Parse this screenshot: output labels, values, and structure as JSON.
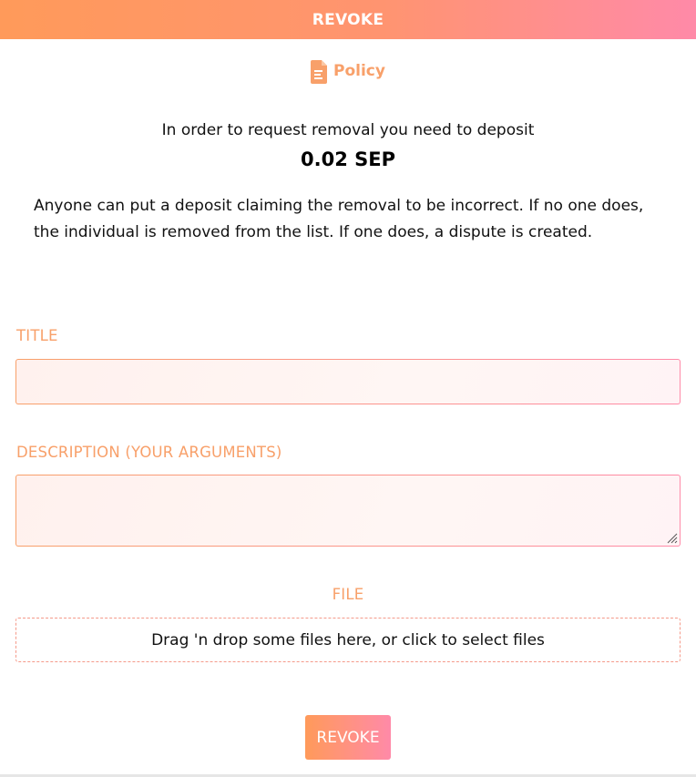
{
  "header": {
    "title": "REVOKE"
  },
  "policy": {
    "label": "Policy",
    "icon": "document-icon"
  },
  "deposit": {
    "intro": "In order to request removal you need to deposit",
    "amount": "0.02 SEP"
  },
  "explanation": "Anyone can put a deposit claiming the removal to be incorrect. If no one does, the individual is removed from the list. If one does, a dispute is created.",
  "form": {
    "title_label": "TITLE",
    "title_value": "",
    "description_label": "DESCRIPTION (YOUR ARGUMENTS)",
    "description_value": "",
    "file_label": "FILE",
    "dropzone_text": "Drag 'n drop some files here, or click to select files"
  },
  "submit": {
    "label": "REVOKE"
  },
  "colors": {
    "accent_orange": "#ff9a5a",
    "accent_pink": "#ff8aa8",
    "label_orange": "#f8a06a"
  }
}
